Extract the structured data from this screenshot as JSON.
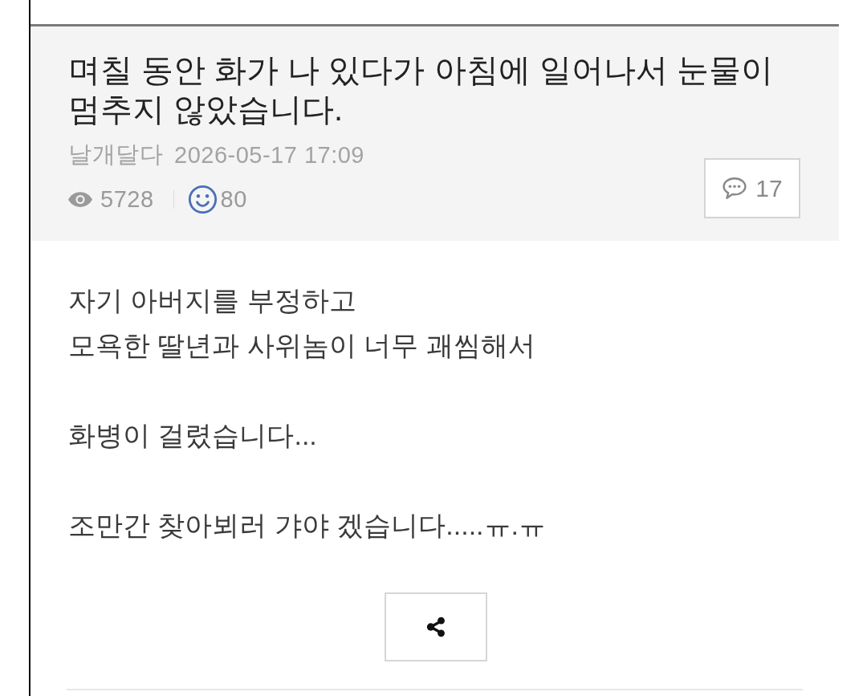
{
  "post": {
    "title": "며칠 동안 화가 나 있다가 아침에 일어나서 눈물이 멈추지 않았습니다.",
    "author": "날개달다",
    "date": "2026-05-17 17:09",
    "views": "5728",
    "reactions": "80",
    "comments": "17"
  },
  "body": {
    "paragraphs": [
      [
        "자기 아버지를 부정하고",
        "모욕한 딸년과 사위놈이 너무 괘씸해서"
      ],
      [
        "화병이 걸렸습니다..."
      ],
      [
        "조만간 찾아뵈러 갸야 겠습니다.....ㅠ.ㅠ"
      ]
    ]
  }
}
